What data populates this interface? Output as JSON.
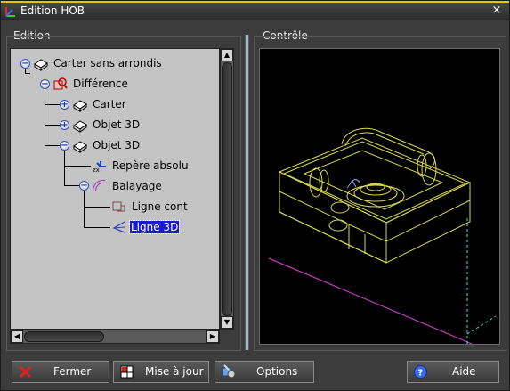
{
  "window": {
    "title": "Edition HOB",
    "close_glyph": "×",
    "accent_color": "#e8c20c"
  },
  "edition_panel": {
    "title": "Edition",
    "tree": [
      {
        "label": "Carter sans arrondis",
        "icon": "solid-object-icon",
        "expander": "−",
        "selected": false
      },
      {
        "label": "Différence",
        "icon": "difference-icon",
        "expander": "−",
        "selected": false
      },
      {
        "label": "Carter",
        "icon": "solid-object-icon",
        "expander": "+",
        "selected": false
      },
      {
        "label": "Objet 3D",
        "icon": "solid-object-icon",
        "expander": "+",
        "selected": false
      },
      {
        "label": "Objet 3D",
        "icon": "solid-object-icon",
        "expander": "−",
        "selected": false
      },
      {
        "label": "Repère absolu",
        "icon": "axis-frame-icon",
        "expander": "",
        "selected": false
      },
      {
        "label": "Balayage",
        "icon": "sweep-icon",
        "expander": "−",
        "selected": false
      },
      {
        "label": "Ligne cont",
        "icon": "contour-line-icon",
        "expander": "",
        "selected": false
      },
      {
        "label": "Ligne 3D",
        "icon": "line-3d-icon",
        "expander": "",
        "selected": true
      }
    ],
    "axis_icon_text": "zx"
  },
  "control_panel": {
    "title": "Contrôle",
    "viewport_bg": "#000000",
    "wire_color": "#e0e05a",
    "axis_colors": [
      "#e040e0",
      "#40e0e0"
    ]
  },
  "buttons": {
    "close": "Fermer",
    "update": "Mise à jour",
    "options": "Options",
    "help": "Aide"
  }
}
